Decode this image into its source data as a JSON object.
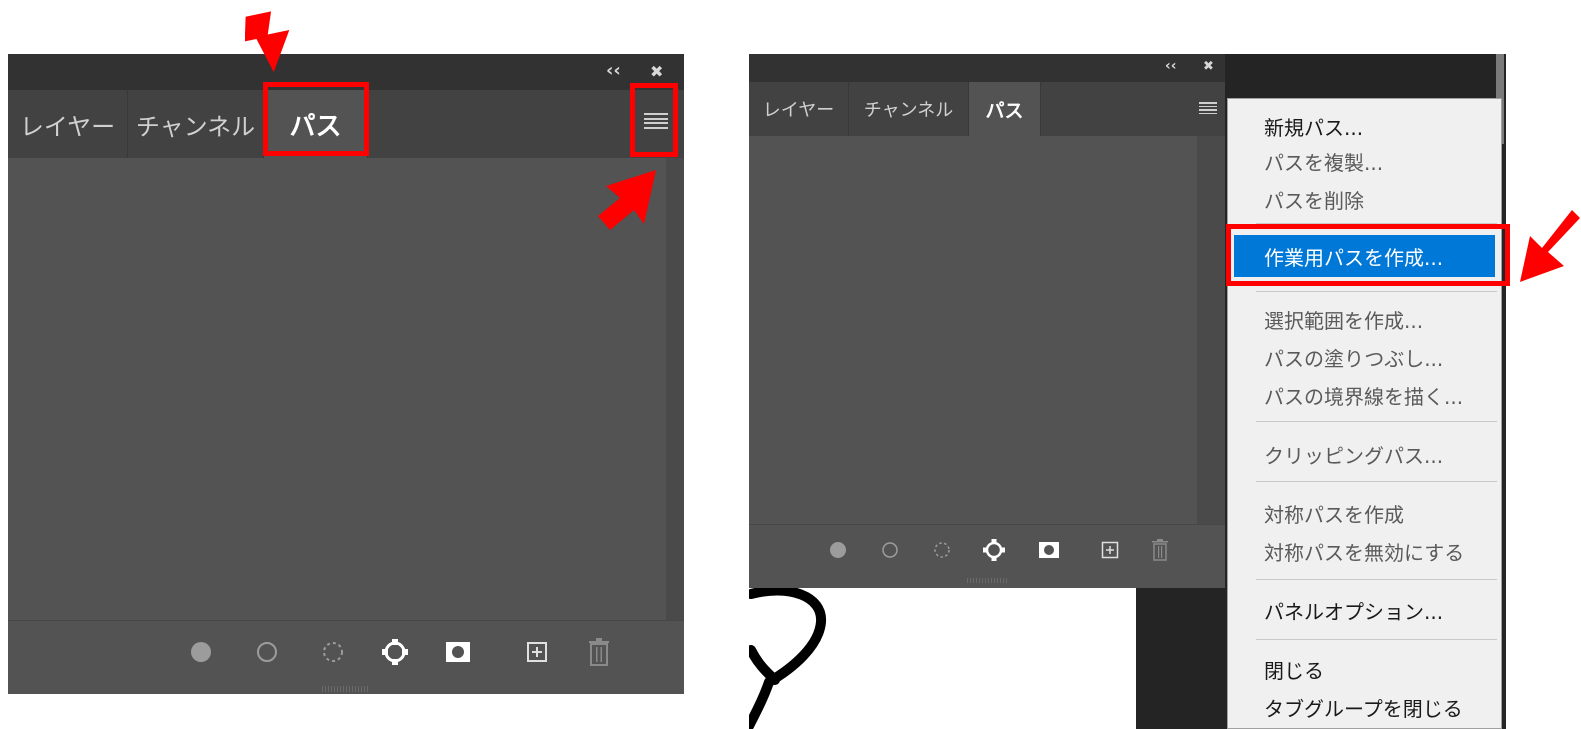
{
  "left_panel": {
    "tabs": [
      "レイヤー",
      "チャンネル",
      "パス"
    ],
    "collapse_glyph": "‹‹",
    "close_glyph": "✖",
    "footer_icons": [
      "fill-path-icon",
      "stroke-path-icon",
      "load-selection-icon",
      "make-work-path-icon",
      "add-mask-icon",
      "new-path-icon",
      "trash-icon"
    ]
  },
  "right_panel": {
    "tabs": [
      "レイヤー",
      "チャンネル",
      "パス"
    ],
    "collapse_glyph": "‹‹",
    "close_glyph": "✖"
  },
  "flyout_menu": {
    "items": [
      {
        "label": "新規パス...",
        "enabled": true
      },
      {
        "label": "パスを複製...",
        "enabled": false
      },
      {
        "label": "パスを削除",
        "enabled": false
      },
      {
        "label": "作業用パスを作成...",
        "enabled": true,
        "highlighted": true
      },
      {
        "label": "選択範囲を作成...",
        "enabled": false
      },
      {
        "label": "パスの塗りつぶし...",
        "enabled": false
      },
      {
        "label": "パスの境界線を描く...",
        "enabled": false
      },
      {
        "label": "クリッピングパス...",
        "enabled": false
      },
      {
        "label": "対称パスを作成",
        "enabled": false
      },
      {
        "label": "対称パスを無効にする",
        "enabled": false
      },
      {
        "label": "パネルオプション...",
        "enabled": true
      },
      {
        "label": "閉じる",
        "enabled": true
      },
      {
        "label": "タブグループを閉じる",
        "enabled": true
      }
    ]
  },
  "colors": {
    "panel_bg": "#535353",
    "highlight": "#0078d7",
    "annotation": "#ff0000"
  }
}
